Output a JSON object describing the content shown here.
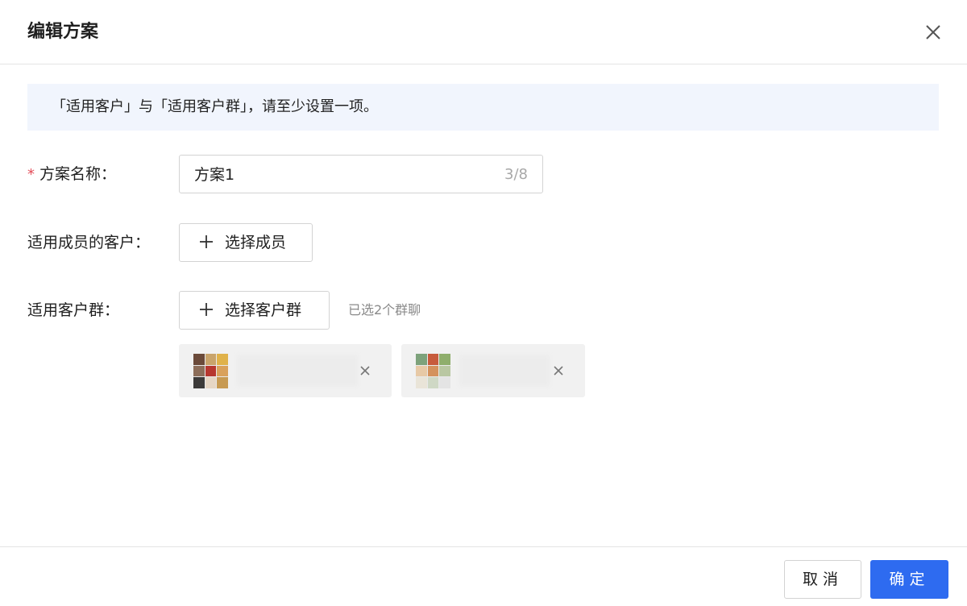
{
  "dialog": {
    "title": "编辑方案"
  },
  "notice": {
    "text": "「适用客户」与「适用客户群」，请至少设置一项。"
  },
  "form": {
    "required_mark": "*",
    "plan_name": {
      "label": "方案名称：",
      "value": "方案1",
      "counter": "3/8"
    },
    "members": {
      "label": "适用成员的客户：",
      "button_label": "选择成员"
    },
    "groups": {
      "label": "适用客户群：",
      "button_label": "选择客户群",
      "selected_hint": "已选2个群聊",
      "selected_chips": [
        {
          "avatar_colors": [
            "#6b4a3a",
            "#c9a46b",
            "#e0b24a",
            "#8d6e5a",
            "#b7372f",
            "#d9a15b",
            "#3d3b3a",
            "#e6d6c4",
            "#c79a52"
          ]
        },
        {
          "avatar_colors": [
            "#7da27b",
            "#c75b3c",
            "#8fae6c",
            "#e7c9a6",
            "#d4925d",
            "#b9c7a2",
            "#e9e4d8",
            "#cfd8c5",
            "#e4e4e4"
          ]
        }
      ]
    }
  },
  "footer": {
    "cancel_label": "取消",
    "confirm_label": "确定"
  },
  "colors": {
    "primary": "#2e6bf0",
    "required": "#e34d59",
    "notice_bg": "#f1f5fd"
  },
  "icons": {
    "close": "close-icon",
    "plus": "plus-icon",
    "remove": "close-icon"
  }
}
